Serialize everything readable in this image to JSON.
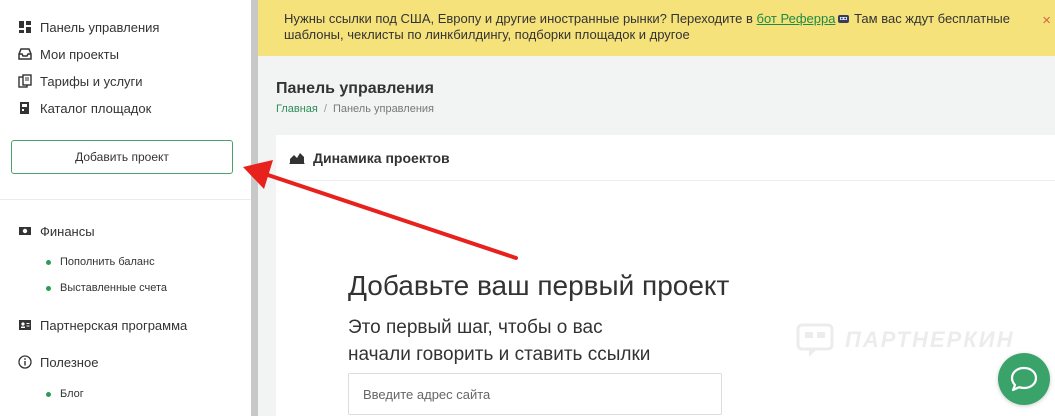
{
  "sidebar": {
    "top_items": [
      {
        "label": "Панель управления",
        "icon": "dashboard-icon"
      },
      {
        "label": "Мои проекты",
        "icon": "inbox-icon"
      },
      {
        "label": "Тарифы и услуги",
        "icon": "documents-icon"
      },
      {
        "label": "Каталог площадок",
        "icon": "catalog-icon"
      }
    ],
    "add_button": "Добавить проект",
    "finance": {
      "label": "Финансы",
      "icon": "money-icon"
    },
    "finance_sub": [
      "Пополнить баланс",
      "Выставленные счета"
    ],
    "partner": {
      "label": "Партнерская программа",
      "icon": "id-card-icon"
    },
    "useful": {
      "label": "Полезное",
      "icon": "info-icon"
    },
    "useful_sub": [
      "Блог"
    ]
  },
  "banner": {
    "text_before": "Нужны ссылки под США, Европу и другие иностранные рынки? Переходите в ",
    "link": "бот Реферра",
    "text_after": " Там вас ждут бесплатные шаблоны, чеклисты по линкбилдингу, подборки площадок и другое",
    "close": "×"
  },
  "main": {
    "title": "Панель управления",
    "breadcrumb_home": "Главная",
    "breadcrumb_sep": "/",
    "breadcrumb_current": "Панель управления",
    "card_title": "Динамика проектов",
    "hero_title": "Добавьте ваш первый проект",
    "hero_sub_line1": "Это первый шаг, чтобы о вас",
    "hero_sub_line2": "начали говорить и ставить ссылки",
    "input_placeholder": "Введите адрес сайта"
  },
  "watermark": "ПАРТНЕРКИН",
  "colors": {
    "accent": "#2e9c55",
    "banner": "#f6e27b",
    "arrow": "#e8211c"
  }
}
